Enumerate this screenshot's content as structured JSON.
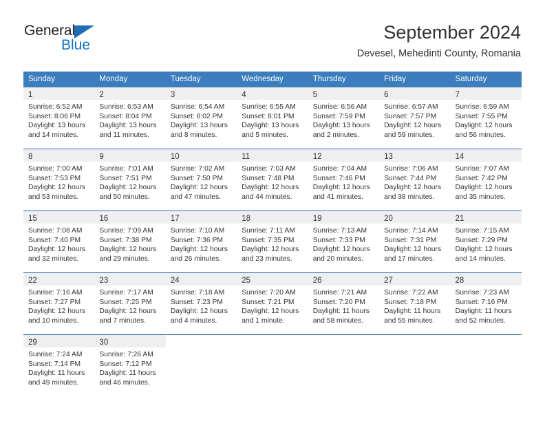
{
  "brand": {
    "name_part1": "General",
    "name_part2": "Blue",
    "triangle_color": "#1f6eb5",
    "accent_color": "#1273c4"
  },
  "header": {
    "title": "September 2024",
    "subtitle": "Devesel, Mehedinti County, Romania"
  },
  "calendar": {
    "header_bg": "#3b7dbd",
    "row_divider_color": "#2b6ca8",
    "daynum_band_color": "#efefef",
    "weekdays": [
      "Sunday",
      "Monday",
      "Tuesday",
      "Wednesday",
      "Thursday",
      "Friday",
      "Saturday"
    ],
    "weeks": [
      [
        {
          "day": "1",
          "sunrise": "Sunrise: 6:52 AM",
          "sunset": "Sunset: 8:06 PM",
          "daylight_line1": "Daylight: 13 hours",
          "daylight_line2": "and 14 minutes."
        },
        {
          "day": "2",
          "sunrise": "Sunrise: 6:53 AM",
          "sunset": "Sunset: 8:04 PM",
          "daylight_line1": "Daylight: 13 hours",
          "daylight_line2": "and 11 minutes."
        },
        {
          "day": "3",
          "sunrise": "Sunrise: 6:54 AM",
          "sunset": "Sunset: 8:02 PM",
          "daylight_line1": "Daylight: 13 hours",
          "daylight_line2": "and 8 minutes."
        },
        {
          "day": "4",
          "sunrise": "Sunrise: 6:55 AM",
          "sunset": "Sunset: 8:01 PM",
          "daylight_line1": "Daylight: 13 hours",
          "daylight_line2": "and 5 minutes."
        },
        {
          "day": "5",
          "sunrise": "Sunrise: 6:56 AM",
          "sunset": "Sunset: 7:59 PM",
          "daylight_line1": "Daylight: 13 hours",
          "daylight_line2": "and 2 minutes."
        },
        {
          "day": "6",
          "sunrise": "Sunrise: 6:57 AM",
          "sunset": "Sunset: 7:57 PM",
          "daylight_line1": "Daylight: 12 hours",
          "daylight_line2": "and 59 minutes."
        },
        {
          "day": "7",
          "sunrise": "Sunrise: 6:59 AM",
          "sunset": "Sunset: 7:55 PM",
          "daylight_line1": "Daylight: 12 hours",
          "daylight_line2": "and 56 minutes."
        }
      ],
      [
        {
          "day": "8",
          "sunrise": "Sunrise: 7:00 AM",
          "sunset": "Sunset: 7:53 PM",
          "daylight_line1": "Daylight: 12 hours",
          "daylight_line2": "and 53 minutes."
        },
        {
          "day": "9",
          "sunrise": "Sunrise: 7:01 AM",
          "sunset": "Sunset: 7:51 PM",
          "daylight_line1": "Daylight: 12 hours",
          "daylight_line2": "and 50 minutes."
        },
        {
          "day": "10",
          "sunrise": "Sunrise: 7:02 AM",
          "sunset": "Sunset: 7:50 PM",
          "daylight_line1": "Daylight: 12 hours",
          "daylight_line2": "and 47 minutes."
        },
        {
          "day": "11",
          "sunrise": "Sunrise: 7:03 AM",
          "sunset": "Sunset: 7:48 PM",
          "daylight_line1": "Daylight: 12 hours",
          "daylight_line2": "and 44 minutes."
        },
        {
          "day": "12",
          "sunrise": "Sunrise: 7:04 AM",
          "sunset": "Sunset: 7:46 PM",
          "daylight_line1": "Daylight: 12 hours",
          "daylight_line2": "and 41 minutes."
        },
        {
          "day": "13",
          "sunrise": "Sunrise: 7:06 AM",
          "sunset": "Sunset: 7:44 PM",
          "daylight_line1": "Daylight: 12 hours",
          "daylight_line2": "and 38 minutes."
        },
        {
          "day": "14",
          "sunrise": "Sunrise: 7:07 AM",
          "sunset": "Sunset: 7:42 PM",
          "daylight_line1": "Daylight: 12 hours",
          "daylight_line2": "and 35 minutes."
        }
      ],
      [
        {
          "day": "15",
          "sunrise": "Sunrise: 7:08 AM",
          "sunset": "Sunset: 7:40 PM",
          "daylight_line1": "Daylight: 12 hours",
          "daylight_line2": "and 32 minutes."
        },
        {
          "day": "16",
          "sunrise": "Sunrise: 7:09 AM",
          "sunset": "Sunset: 7:38 PM",
          "daylight_line1": "Daylight: 12 hours",
          "daylight_line2": "and 29 minutes."
        },
        {
          "day": "17",
          "sunrise": "Sunrise: 7:10 AM",
          "sunset": "Sunset: 7:36 PM",
          "daylight_line1": "Daylight: 12 hours",
          "daylight_line2": "and 26 minutes."
        },
        {
          "day": "18",
          "sunrise": "Sunrise: 7:11 AM",
          "sunset": "Sunset: 7:35 PM",
          "daylight_line1": "Daylight: 12 hours",
          "daylight_line2": "and 23 minutes."
        },
        {
          "day": "19",
          "sunrise": "Sunrise: 7:13 AM",
          "sunset": "Sunset: 7:33 PM",
          "daylight_line1": "Daylight: 12 hours",
          "daylight_line2": "and 20 minutes."
        },
        {
          "day": "20",
          "sunrise": "Sunrise: 7:14 AM",
          "sunset": "Sunset: 7:31 PM",
          "daylight_line1": "Daylight: 12 hours",
          "daylight_line2": "and 17 minutes."
        },
        {
          "day": "21",
          "sunrise": "Sunrise: 7:15 AM",
          "sunset": "Sunset: 7:29 PM",
          "daylight_line1": "Daylight: 12 hours",
          "daylight_line2": "and 14 minutes."
        }
      ],
      [
        {
          "day": "22",
          "sunrise": "Sunrise: 7:16 AM",
          "sunset": "Sunset: 7:27 PM",
          "daylight_line1": "Daylight: 12 hours",
          "daylight_line2": "and 10 minutes."
        },
        {
          "day": "23",
          "sunrise": "Sunrise: 7:17 AM",
          "sunset": "Sunset: 7:25 PM",
          "daylight_line1": "Daylight: 12 hours",
          "daylight_line2": "and 7 minutes."
        },
        {
          "day": "24",
          "sunrise": "Sunrise: 7:18 AM",
          "sunset": "Sunset: 7:23 PM",
          "daylight_line1": "Daylight: 12 hours",
          "daylight_line2": "and 4 minutes."
        },
        {
          "day": "25",
          "sunrise": "Sunrise: 7:20 AM",
          "sunset": "Sunset: 7:21 PM",
          "daylight_line1": "Daylight: 12 hours",
          "daylight_line2": "and 1 minute."
        },
        {
          "day": "26",
          "sunrise": "Sunrise: 7:21 AM",
          "sunset": "Sunset: 7:20 PM",
          "daylight_line1": "Daylight: 11 hours",
          "daylight_line2": "and 58 minutes."
        },
        {
          "day": "27",
          "sunrise": "Sunrise: 7:22 AM",
          "sunset": "Sunset: 7:18 PM",
          "daylight_line1": "Daylight: 11 hours",
          "daylight_line2": "and 55 minutes."
        },
        {
          "day": "28",
          "sunrise": "Sunrise: 7:23 AM",
          "sunset": "Sunset: 7:16 PM",
          "daylight_line1": "Daylight: 11 hours",
          "daylight_line2": "and 52 minutes."
        }
      ],
      [
        {
          "day": "29",
          "sunrise": "Sunrise: 7:24 AM",
          "sunset": "Sunset: 7:14 PM",
          "daylight_line1": "Daylight: 11 hours",
          "daylight_line2": "and 49 minutes."
        },
        {
          "day": "30",
          "sunrise": "Sunrise: 7:26 AM",
          "sunset": "Sunset: 7:12 PM",
          "daylight_line1": "Daylight: 11 hours",
          "daylight_line2": "and 46 minutes."
        },
        {
          "day": "",
          "sunrise": "",
          "sunset": "",
          "daylight_line1": "",
          "daylight_line2": ""
        },
        {
          "day": "",
          "sunrise": "",
          "sunset": "",
          "daylight_line1": "",
          "daylight_line2": ""
        },
        {
          "day": "",
          "sunrise": "",
          "sunset": "",
          "daylight_line1": "",
          "daylight_line2": ""
        },
        {
          "day": "",
          "sunrise": "",
          "sunset": "",
          "daylight_line1": "",
          "daylight_line2": ""
        },
        {
          "day": "",
          "sunrise": "",
          "sunset": "",
          "daylight_line1": "",
          "daylight_line2": ""
        }
      ]
    ]
  }
}
